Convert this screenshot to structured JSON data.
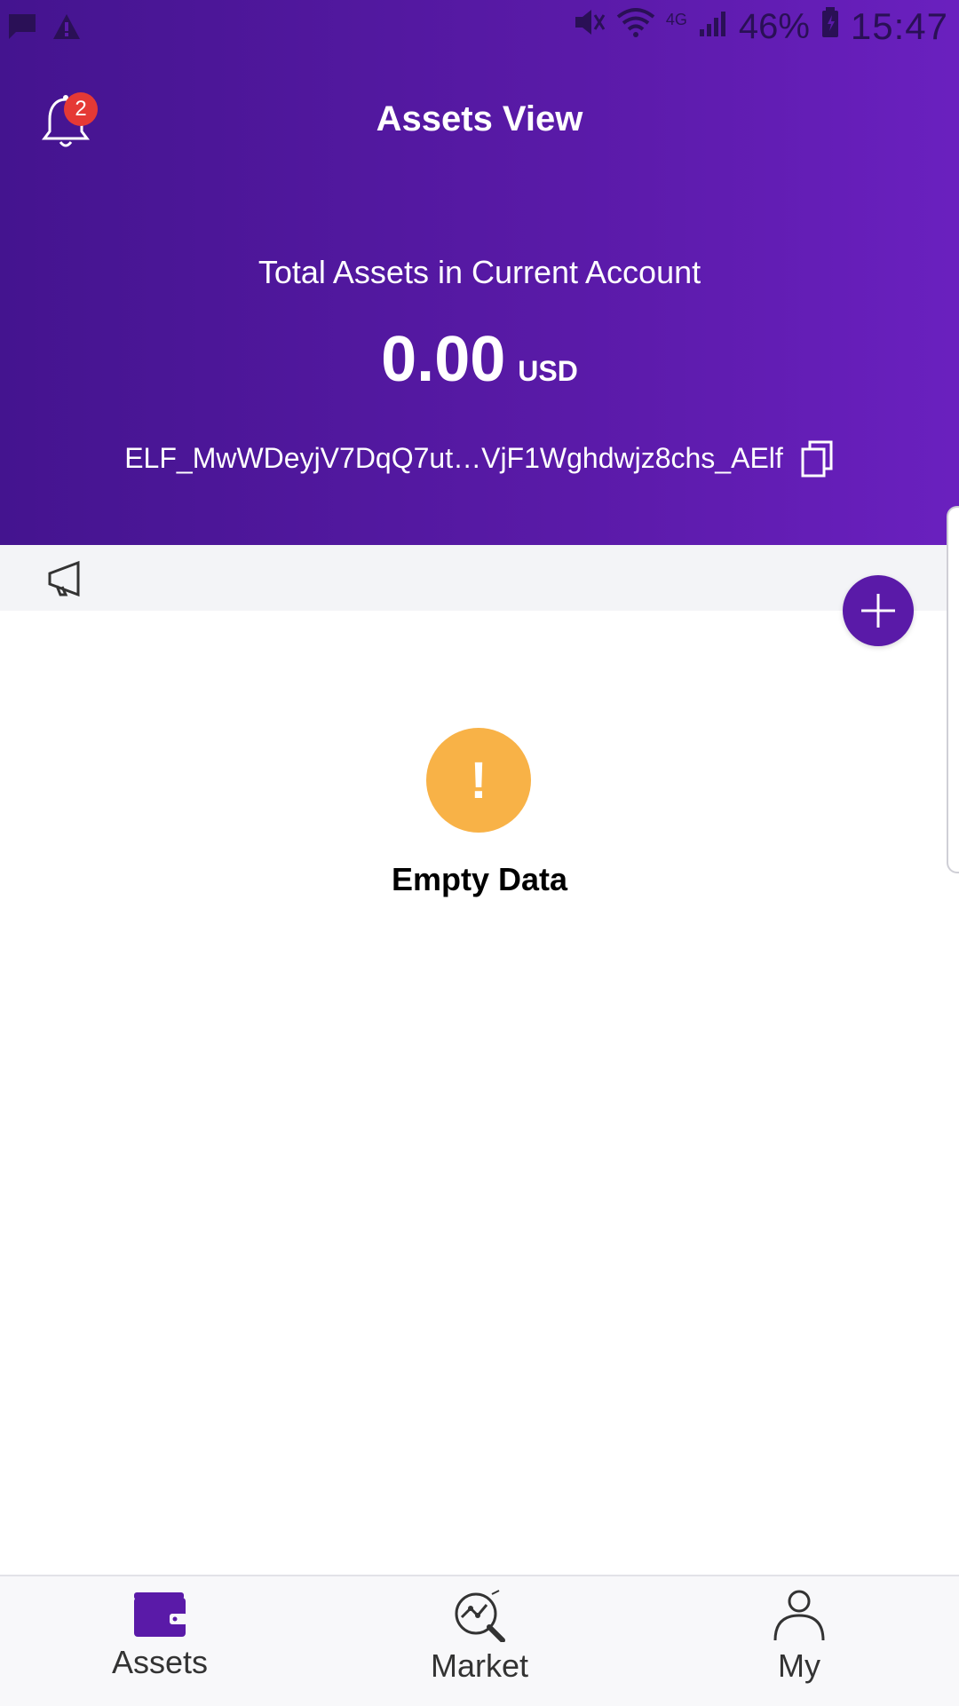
{
  "status_bar": {
    "battery": "46%",
    "time": "15:47",
    "network": "4G"
  },
  "header": {
    "title": "Assets View",
    "notification_count": "2",
    "subtitle": "Total Assets in Current Account",
    "balance_amount": "0.00",
    "balance_unit": "USD",
    "address": "ELF_MwWDeyjV7DqQ7ut…VjF1Wghdwjz8chs_AElf"
  },
  "empty_state": {
    "icon_glyph": "!",
    "text": "Empty Data"
  },
  "tabs": [
    {
      "label": "Assets",
      "icon": "wallet-icon",
      "active": true
    },
    {
      "label": "Market",
      "icon": "market-icon",
      "active": false
    },
    {
      "label": "My",
      "icon": "person-icon",
      "active": false
    }
  ],
  "colors": {
    "header_gradient_start": "#44148f",
    "header_gradient_end": "#6a20bf",
    "accent": "#5a1aa8",
    "empty_icon": "#f8b247",
    "badge": "#e53935"
  }
}
